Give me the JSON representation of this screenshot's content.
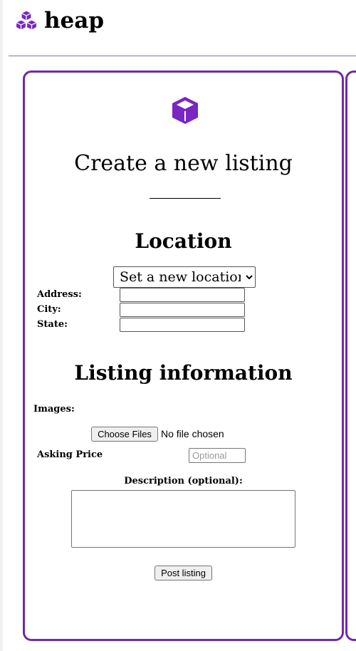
{
  "header": {
    "logo_text": "heap"
  },
  "form": {
    "title": "Create a new listing",
    "location": {
      "heading": "Location",
      "select_value": "Set a new location",
      "address_label": "Address:",
      "city_label": "City:",
      "state_label": "State:"
    },
    "listing_info": {
      "heading": "Listing information",
      "images_label": "Images:",
      "choose_files_label": "Choose Files",
      "file_status": "No file chosen",
      "asking_price_label": "Asking Price",
      "asking_price_placeholder": "Optional",
      "description_label": "Description (optional):"
    },
    "submit_label": "Post listing"
  },
  "colors": {
    "brand_purple": "#6f2aa8",
    "icon_purple": "#7a26c1"
  }
}
